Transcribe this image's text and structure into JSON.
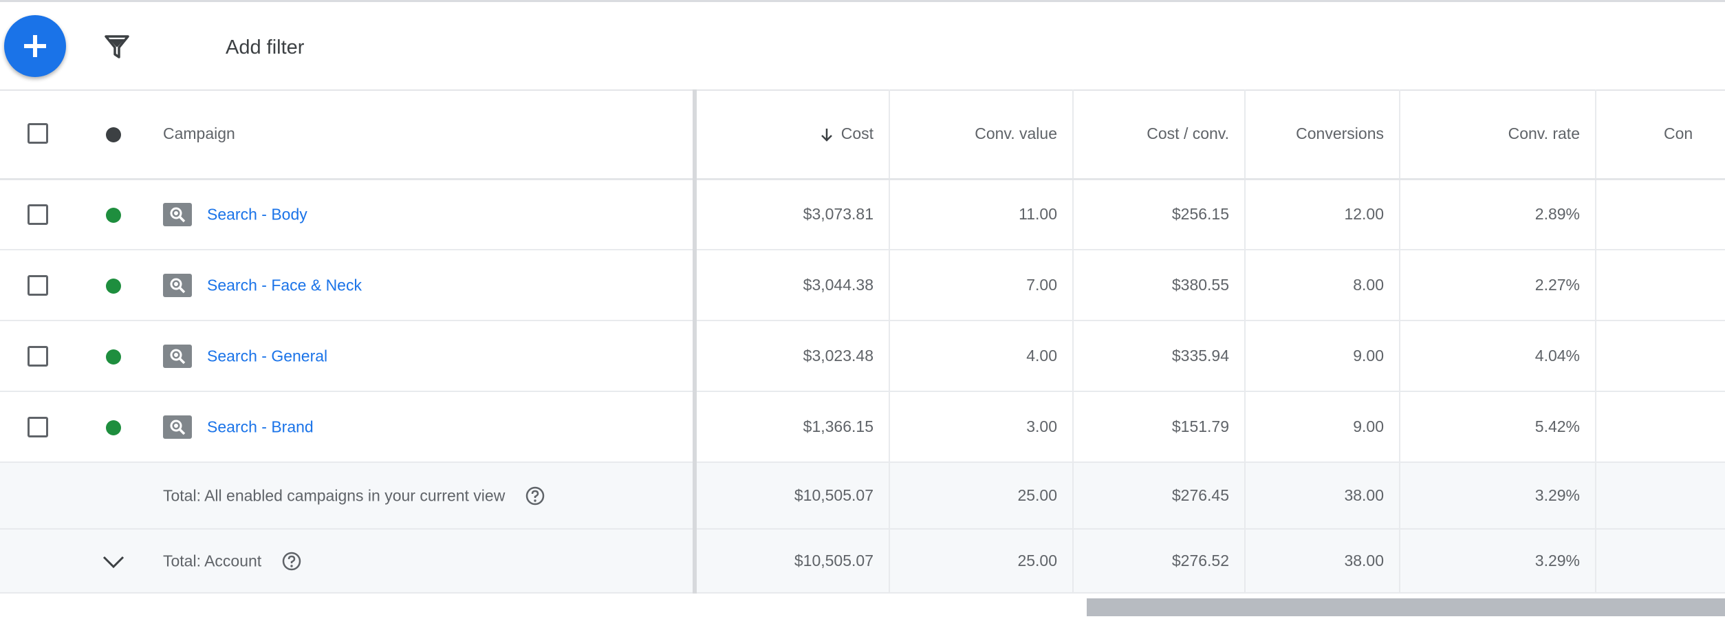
{
  "toolbar": {
    "add_icon": "plus-icon",
    "filter_icon": "funnel-icon",
    "add_filter_label": "Add filter"
  },
  "table": {
    "headers": {
      "campaign": "Campaign",
      "cost": "Cost",
      "conv_value": "Conv. value",
      "cost_per_conv": "Cost / conv.",
      "conversions": "Conversions",
      "conv_rate": "Conv. rate",
      "next": "Con"
    },
    "sort_icon": "arrow-down-icon",
    "rows": [
      {
        "name": "Search - Body",
        "cost": "$3,073.81",
        "conv_value": "11.00",
        "cost_per_conv": "$256.15",
        "conversions": "12.00",
        "conv_rate": "2.89%"
      },
      {
        "name": "Search - Face & Neck",
        "cost": "$3,044.38",
        "conv_value": "7.00",
        "cost_per_conv": "$380.55",
        "conversions": "8.00",
        "conv_rate": "2.27%"
      },
      {
        "name": "Search - General",
        "cost": "$3,023.48",
        "conv_value": "4.00",
        "cost_per_conv": "$335.94",
        "conversions": "9.00",
        "conv_rate": "4.04%"
      },
      {
        "name": "Search - Brand",
        "cost": "$1,366.15",
        "conv_value": "3.00",
        "cost_per_conv": "$151.79",
        "conversions": "9.00",
        "conv_rate": "5.42%"
      }
    ],
    "totals": [
      {
        "label": "Total: All enabled campaigns in your current view",
        "cost": "$10,505.07",
        "conv_value": "25.00",
        "cost_per_conv": "$276.45",
        "conversions": "38.00",
        "conv_rate": "3.29%"
      },
      {
        "label": "Total: Account",
        "cost": "$10,505.07",
        "conv_value": "25.00",
        "cost_per_conv": "$276.52",
        "conversions": "38.00",
        "conv_rate": "3.29%"
      }
    ]
  },
  "colors": {
    "accent": "#1a73e8",
    "status_enabled": "#1e8e3e",
    "header_dot": "#3c4043"
  }
}
